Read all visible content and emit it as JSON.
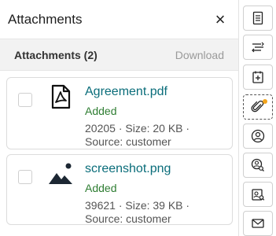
{
  "header": {
    "title": "Attachments",
    "close_glyph": "×"
  },
  "subheader": {
    "title": "Attachments (2)",
    "download_label": "Download"
  },
  "attachments": [
    {
      "name": "Agreement.pdf",
      "status": "Added",
      "meta_line1": "20205 · Size: 20 KB ·",
      "meta_line2": "Source: customer",
      "icon": "pdf-file-icon"
    },
    {
      "name": "screenshot.png",
      "status": "Added",
      "meta_line1": "39621 · Size: 39 KB ·",
      "meta_line2": "Source: customer",
      "icon": "image-file-icon"
    }
  ],
  "rail": {
    "items": [
      {
        "icon": "document-icon"
      },
      {
        "icon": "list-icon"
      },
      {
        "icon": "add-note-icon"
      },
      {
        "icon": "paperclip-icon",
        "active": true,
        "badge": true
      },
      {
        "icon": "user-circle-icon"
      },
      {
        "icon": "user-search-icon"
      },
      {
        "icon": "contact-card-icon"
      },
      {
        "icon": "mail-icon"
      }
    ]
  },
  "colors": {
    "link": "#0a6d7a",
    "status": "#2e7d32",
    "badge": "#f3a51c",
    "subheader_bg": "#f2f2f2"
  }
}
